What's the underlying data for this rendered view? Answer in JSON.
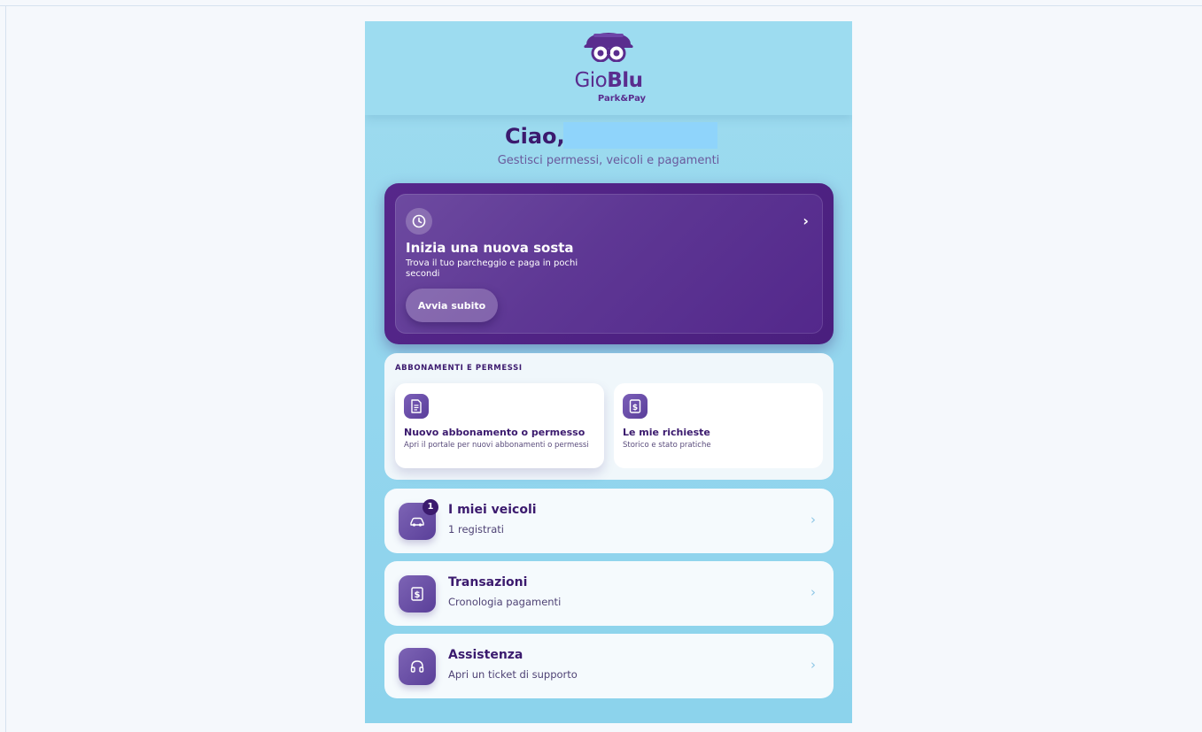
{
  "brand": {
    "logo_thin": "Gio",
    "logo_bold": "Blu",
    "logo_sub": "Park&Pay"
  },
  "greeting": {
    "hello": "Ciao,",
    "subtitle": "Gestisci permessi, veicoli e pagamenti"
  },
  "hero": {
    "icon": "clock-icon",
    "title": "Inizia una nuova sosta",
    "description": "Trova il tuo parcheggio e paga in pochi secondi",
    "button_label": "Avvia subito",
    "chevron": "›"
  },
  "permits": {
    "section_title": "ABBONAMENTI E PERMESSI",
    "tiles": [
      {
        "icon": "document-icon",
        "title": "Nuovo abbonamento o permesso",
        "description": "Apri il portale per nuovi abbonamenti o permessi"
      },
      {
        "icon": "receipt-icon",
        "title": "Le mie richieste",
        "description": "Storico e stato pratiche"
      }
    ]
  },
  "menu": [
    {
      "icon": "car-icon",
      "title": "I miei veicoli",
      "subtitle": "1 registrati",
      "badge": "1",
      "chevron": "›"
    },
    {
      "icon": "receipt-icon",
      "title": "Transazioni",
      "subtitle": "Cronologia pagamenti",
      "chevron": "›"
    },
    {
      "icon": "headset-icon",
      "title": "Assistenza",
      "subtitle": "Apri un ticket di supporto",
      "chevron": "›"
    }
  ],
  "colors": {
    "brand_purple": "#5a2d8e",
    "dark_purple": "#3b1a6e",
    "sky_background": "#94d6ee"
  }
}
